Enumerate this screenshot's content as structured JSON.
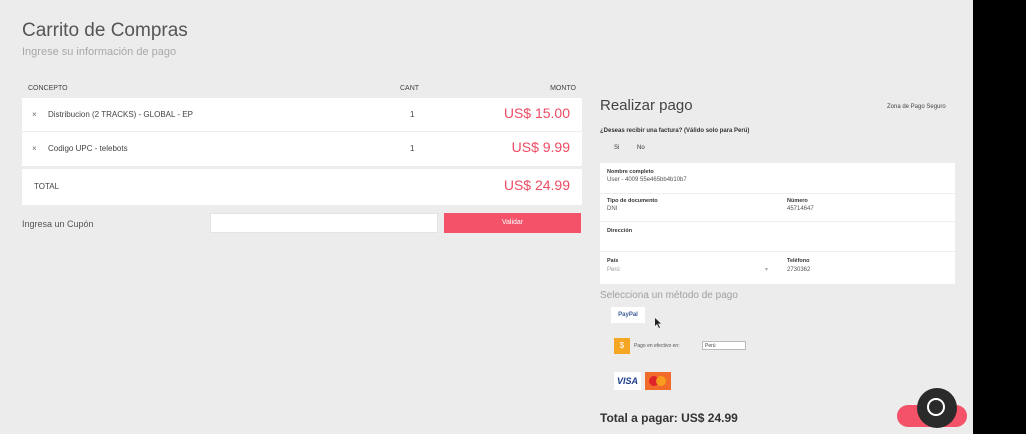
{
  "header": {
    "title": "Carrito de Compras",
    "subtitle": "Ingrese su información de pago"
  },
  "cart": {
    "columns": {
      "concept": "CONCEPTO",
      "qty": "CANT",
      "amount": "MONTO"
    },
    "items": [
      {
        "remove": "×",
        "concept": "Distribucion (2 TRACKS) - GLOBAL - EP",
        "qty": "1",
        "amount": "US$ 15.00"
      },
      {
        "remove": "×",
        "concept": "Codigo UPC - telebots",
        "qty": "1",
        "amount": "US$ 9.99"
      }
    ],
    "total_label": "TOTAL",
    "total_amount": "US$ 24.99"
  },
  "coupon": {
    "label": "Ingresa un Cupón",
    "button": "Validar"
  },
  "payment": {
    "title": "Realizar pago",
    "secure_zone": "Zona de Pago Seguro",
    "invoice_question": "¿Deseas recibir una factura? (Válido solo para Perú)",
    "invoice_options": [
      "Si",
      "No"
    ],
    "form": {
      "fullname_label": "Nombre completo",
      "fullname_value": "User - 4009 55e465bb4b10b7",
      "doc_type_label": "Tipo de documento",
      "doc_type_value": "DNI",
      "number_label": "Número",
      "number_value": "45714647",
      "address_label": "Dirección",
      "country_label": "País",
      "country_value": "Perú",
      "phone_label": "Teléfono",
      "phone_value": "2730362"
    },
    "method_title": "Selecciona un método de pago",
    "paypal_label": "PayPal",
    "cash_label": "Pago en efectivo en:",
    "cash_country": "Perú",
    "visa_label": "VISA",
    "total_text": "Total a pagar: US$ 24.99"
  },
  "colors": {
    "accent": "#f35268",
    "price": "#ee4a62",
    "cash": "#f5a623"
  }
}
